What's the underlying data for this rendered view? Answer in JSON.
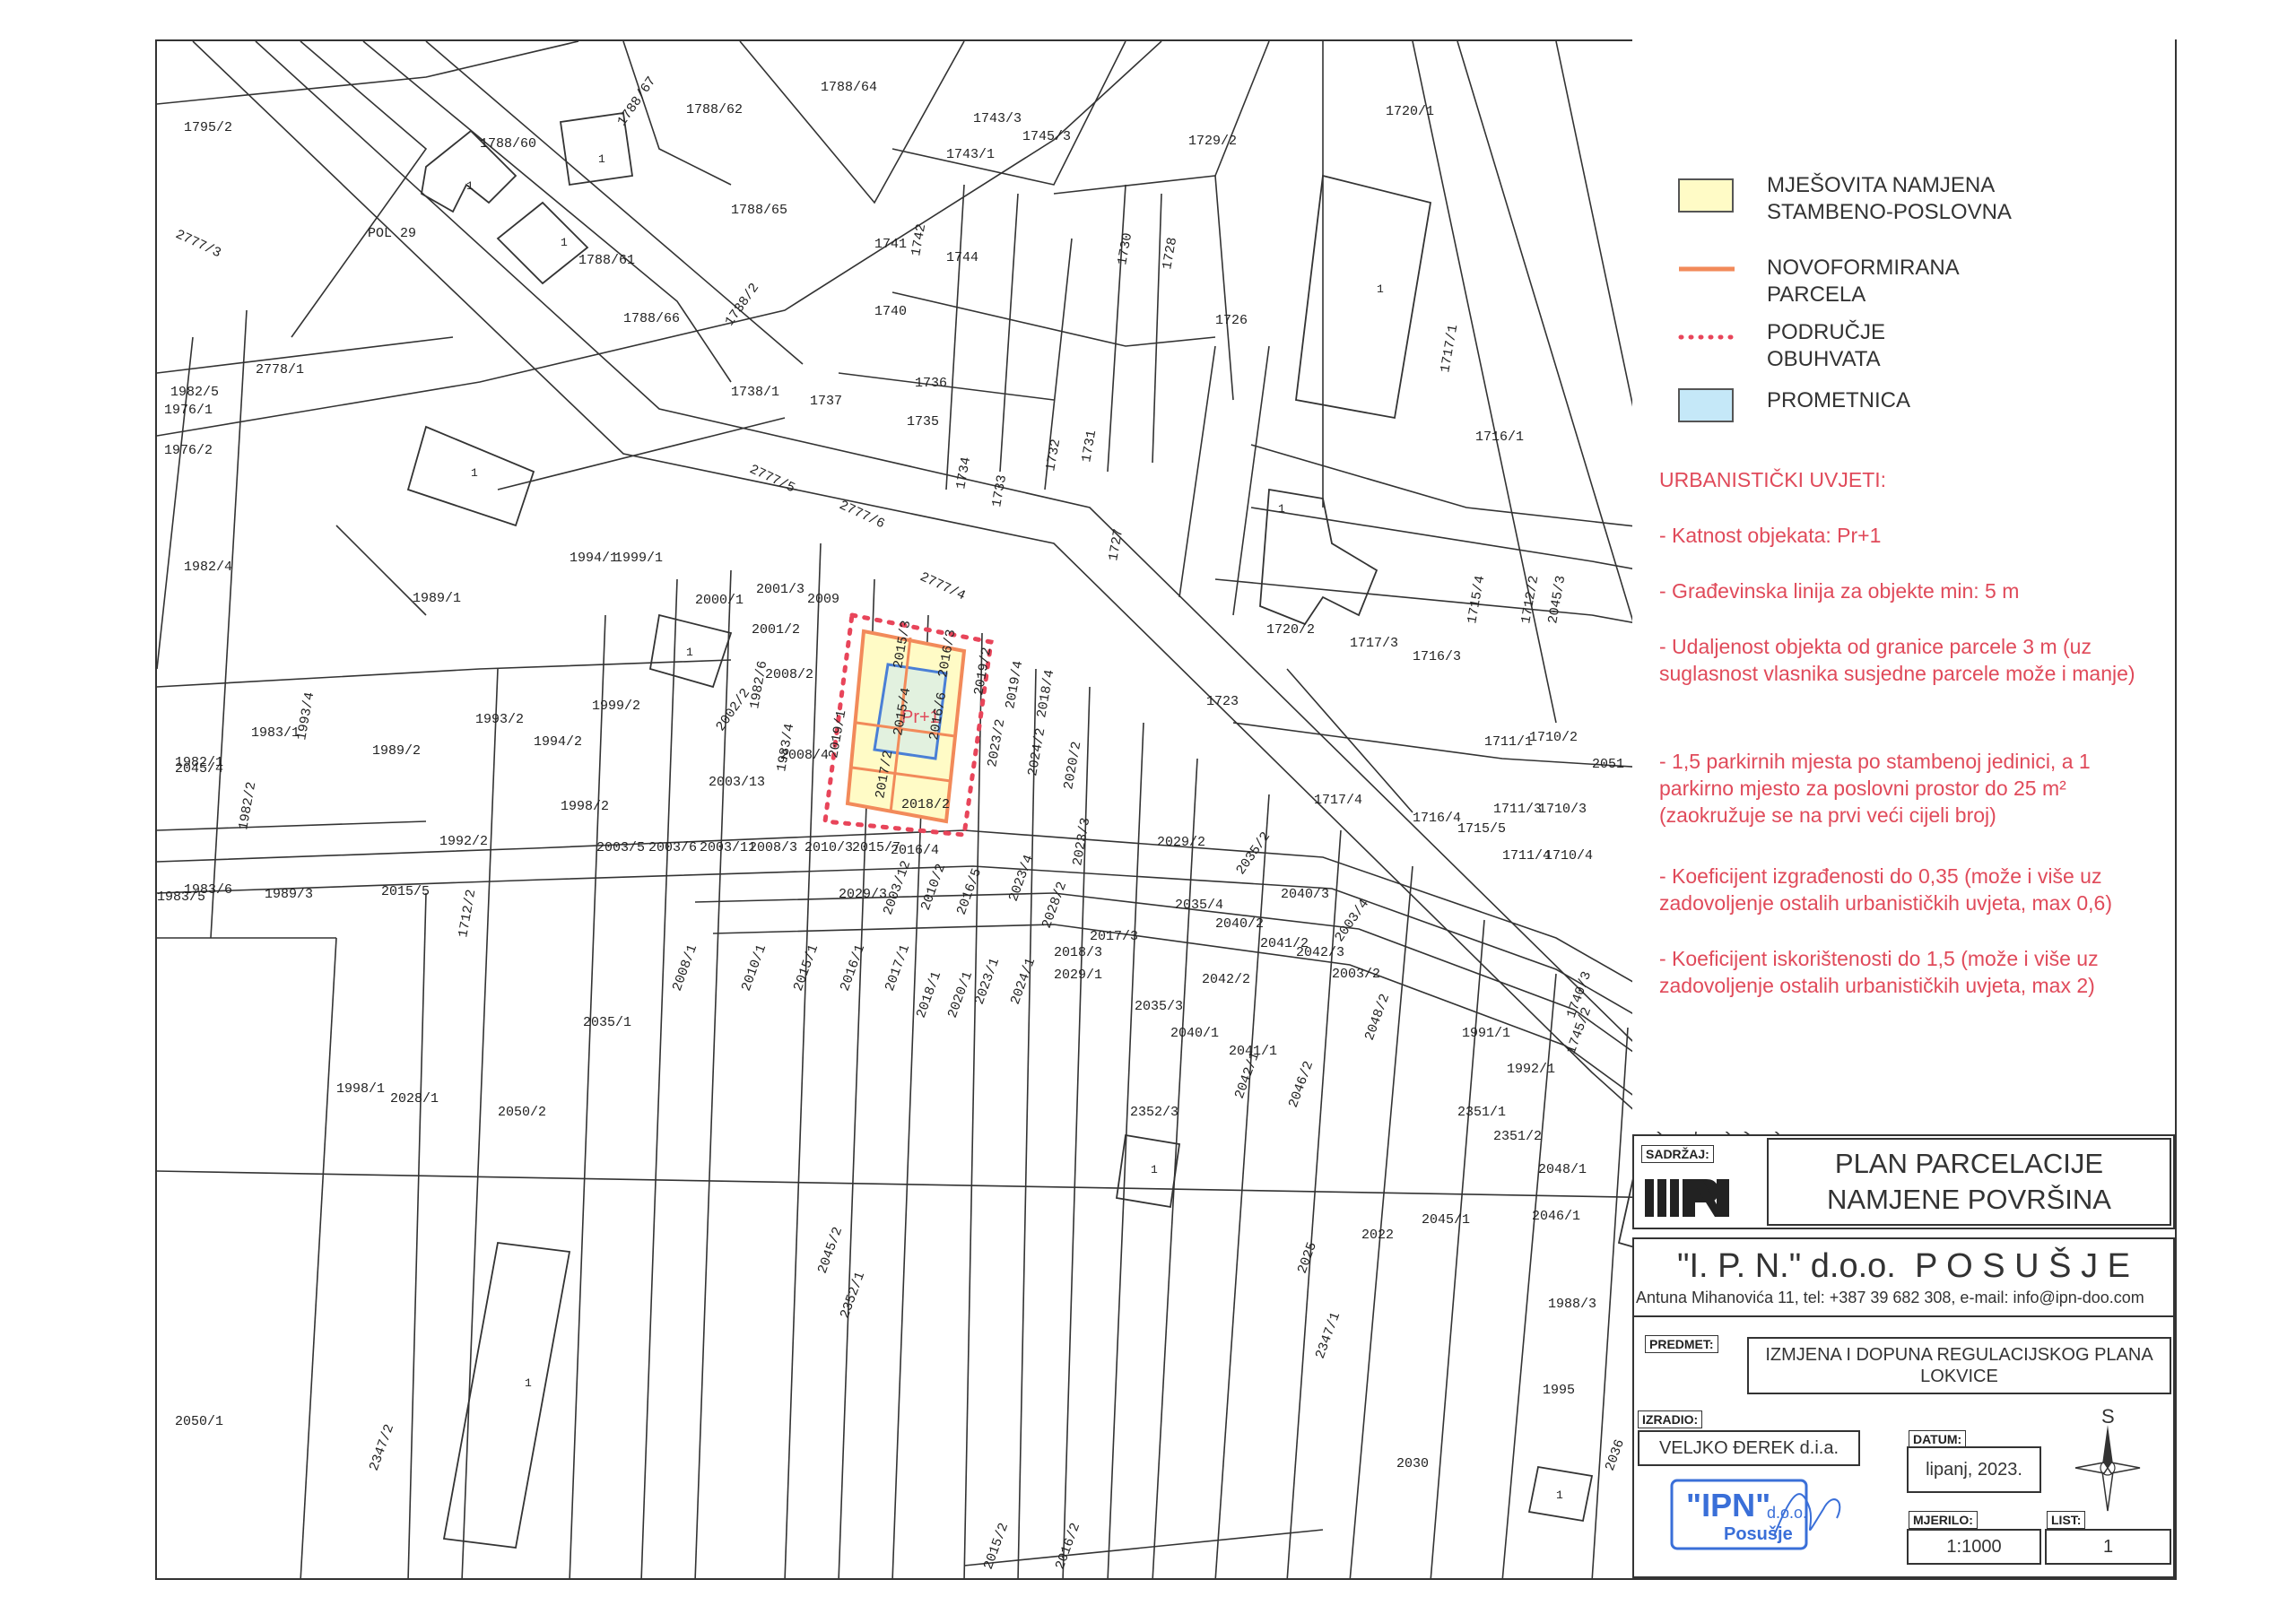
{
  "parcels": [
    {
      "id": "1795/2"
    },
    {
      "id": "1788/67"
    },
    {
      "id": "1788/62"
    },
    {
      "id": "1788/64"
    },
    {
      "id": "1788/60"
    },
    {
      "id": "1788/65"
    },
    {
      "id": "1788/61"
    },
    {
      "id": "1788/66"
    },
    {
      "id": "2777/3"
    },
    {
      "id": "POL 29"
    },
    {
      "id": "1738/2"
    },
    {
      "id": "1741"
    },
    {
      "id": "1742"
    },
    {
      "id": "1744"
    },
    {
      "id": "1740"
    },
    {
      "id": "1736"
    },
    {
      "id": "1737"
    },
    {
      "id": "1735"
    },
    {
      "id": "1738/1"
    },
    {
      "id": "1743/1"
    },
    {
      "id": "1743/3"
    },
    {
      "id": "1745/3"
    },
    {
      "id": "1729/2"
    },
    {
      "id": "1720/1"
    },
    {
      "id": "1730"
    },
    {
      "id": "1728"
    },
    {
      "id": "1726"
    },
    {
      "id": "1717/1"
    },
    {
      "id": "1716/1"
    },
    {
      "id": "2778/1"
    },
    {
      "id": "1982/5"
    },
    {
      "id": "1976/1"
    },
    {
      "id": "1976/2"
    },
    {
      "id": "2777/5"
    },
    {
      "id": "2777/6"
    },
    {
      "id": "2777/4"
    },
    {
      "id": "1734"
    },
    {
      "id": "1733"
    },
    {
      "id": "1732"
    },
    {
      "id": "1731"
    },
    {
      "id": "1727"
    },
    {
      "id": "1982/4"
    },
    {
      "id": "1989/1"
    },
    {
      "id": "1994/1"
    },
    {
      "id": "1999/1"
    },
    {
      "id": "2000/1"
    },
    {
      "id": "2001/3"
    },
    {
      "id": "2001/2"
    },
    {
      "id": "2009"
    },
    {
      "id": "2008/2"
    },
    {
      "id": "1720/2"
    },
    {
      "id": "1717/3"
    },
    {
      "id": "1716/3"
    },
    {
      "id": "1715/4"
    },
    {
      "id": "1712/2"
    },
    {
      "id": "1983/1"
    },
    {
      "id": "1982/1"
    },
    {
      "id": "1993/2"
    },
    {
      "id": "1994/2"
    },
    {
      "id": "1999/2"
    },
    {
      "id": "2002/2"
    },
    {
      "id": "2003/13"
    },
    {
      "id": "2008/4"
    },
    {
      "id": "1998/2"
    },
    {
      "id": "1989/2"
    },
    {
      "id": "1723"
    },
    {
      "id": "1711/1"
    },
    {
      "id": "1710/2"
    },
    {
      "id": "2051"
    },
    {
      "id": "1717/4"
    },
    {
      "id": "1716/4"
    },
    {
      "id": "1715/5"
    },
    {
      "id": "1711/3"
    },
    {
      "id": "1710/3"
    },
    {
      "id": "1711/4"
    },
    {
      "id": "1710/4"
    },
    {
      "id": "1992/2"
    },
    {
      "id": "2003/5"
    },
    {
      "id": "2003/6"
    },
    {
      "id": "2003/11"
    },
    {
      "id": "2008/3"
    },
    {
      "id": "2010/3"
    },
    {
      "id": "2015/7"
    },
    {
      "id": "2016/4"
    },
    {
      "id": "2029/2"
    },
    {
      "id": "2035/2"
    },
    {
      "id": "2040/3"
    },
    {
      "id": "1983/6"
    },
    {
      "id": "1989/3"
    },
    {
      "id": "2015/5"
    },
    {
      "id": "2029/3"
    },
    {
      "id": "2035/4"
    },
    {
      "id": "2040/2"
    },
    {
      "id": "2041/2"
    },
    {
      "id": "2042/3"
    },
    {
      "id": "2003/4"
    },
    {
      "id": "2008/1"
    },
    {
      "id": "2010/1"
    },
    {
      "id": "2015/1"
    },
    {
      "id": "2016/1"
    },
    {
      "id": "2017/1"
    },
    {
      "id": "2018/1"
    },
    {
      "id": "2020/1"
    },
    {
      "id": "2023/1"
    },
    {
      "id": "2024/1"
    },
    {
      "id": "2029/1"
    },
    {
      "id": "2035/3"
    },
    {
      "id": "2042/2"
    },
    {
      "id": "2003/2"
    },
    {
      "id": "2035/1"
    },
    {
      "id": "2040/1"
    },
    {
      "id": "2041/1"
    },
    {
      "id": "2042/1"
    },
    {
      "id": "2046/2"
    },
    {
      "id": "2048/2"
    },
    {
      "id": "1991/1"
    },
    {
      "id": "1992/1"
    },
    {
      "id": "1998/1"
    },
    {
      "id": "2028/1"
    },
    {
      "id": "2050/2"
    },
    {
      "id": "2352/3"
    },
    {
      "id": "2351/1"
    },
    {
      "id": "2351/2"
    },
    {
      "id": "2048/1"
    },
    {
      "id": "2046/1"
    },
    {
      "id": "2045/1"
    },
    {
      "id": "2022"
    },
    {
      "id": "2025"
    },
    {
      "id": "2045/2"
    },
    {
      "id": "2352/1"
    },
    {
      "id": "2347/1"
    },
    {
      "id": "1988/3"
    },
    {
      "id": "1995"
    },
    {
      "id": "2050/1"
    },
    {
      "id": "2347/2"
    },
    {
      "id": "2030"
    },
    {
      "id": "2036"
    },
    {
      "id": "2015/2"
    },
    {
      "id": "2016/2"
    },
    {
      "id": "2015/3"
    },
    {
      "id": "2016/3"
    },
    {
      "id": "2015/4"
    },
    {
      "id": "2016/6"
    },
    {
      "id": "2017/2"
    },
    {
      "id": "2018/2"
    },
    {
      "id": "2019/2"
    },
    {
      "id": "2019/4"
    },
    {
      "id": "2018/4"
    },
    {
      "id": "2019/1"
    },
    {
      "id": "2023/2"
    },
    {
      "id": "2024/2"
    },
    {
      "id": "2020/2"
    },
    {
      "id": "2023/3"
    },
    {
      "id": "2023/4"
    },
    {
      "id": "2028/2"
    },
    {
      "id": "2018/3"
    },
    {
      "id": "2017/3"
    },
    {
      "id": "2016/5"
    },
    {
      "id": "2010/2"
    },
    {
      "id": "2003/12"
    },
    {
      "id": "1982/6"
    },
    {
      "id": "1983/4"
    },
    {
      "id": "1983/5"
    },
    {
      "id": "1993/4"
    },
    {
      "id": "1982/2"
    },
    {
      "id": "1712/2"
    },
    {
      "id": "2045/4"
    },
    {
      "id": "2045/3"
    },
    {
      "id": "1740/3"
    },
    {
      "id": "1745/2"
    }
  ],
  "building_mark": "1",
  "zone_label": "Pr+1",
  "legend": {
    "items": [
      {
        "label": "MJEŠOVITA NAMJENA\nSTAMBENO-POSLOVNA",
        "swatch_fill": "#fffbc6",
        "swatch_stroke": "#555555"
      },
      {
        "label": "NOVOFORMIRANA PARCELA",
        "line_color": "#f28a5a"
      },
      {
        "label": "PODRUČJE OBUHVATA",
        "dot_color": "#e8455a"
      },
      {
        "label": "PROMETNICA",
        "swatch_fill": "#c5e8f8",
        "swatch_stroke": "#555555"
      }
    ],
    "conditions_title": "URBANISTIČKI UVJETI:",
    "conditions": [
      "- Katnost objekata: Pr+1",
      "- Građevinska linija za objekte min: 5 m",
      "- Udaljenost objekta od granice parcele 3 m (uz suglasnost vlasnika susjedne parcele može i manje)",
      "- 1,5 parkirnih mjesta po stambenoj jedinici, a 1 parkirno mjesto za poslovni prostor do 25 m² (zaokružuje se na prvi veći cijeli broj)",
      "- Koeficijent izgrađenosti do 0,35 (može i više uz zadovoljenje ostalih urbanističkih uvjeta, max 0,6)",
      "- Koeficijent iskorištenosti do 1,5 (može i više uz zadovoljenje ostalih urbanističkih uvjeta, max 2)"
    ],
    "condition_color": "#e04a5a"
  },
  "titleblock": {
    "sadrzaj_label": "SADRŽAJ:",
    "logo_text": "IPN",
    "title_line1": "PLAN PARCELACIJE",
    "title_line2": "NAMJENE POVRŠINA",
    "company": "\"I. P. N.\" d.o.o.  P O S U Š J E",
    "address": "Antuna Mihanovića 11,  tel: +387 39 682 308, e-mail: info@ipn-doo.com",
    "predmet_label": "PREDMET:",
    "predmet_line1": "IZMJENA I DOPUNA REGULACIJSKOG PLANA",
    "predmet_line2": "LOKVICE",
    "izradio_label": "IZRADIO:",
    "izradio": "VELJKO ĐEREK d.i.a.",
    "datum_label": "DATUM:",
    "datum": "lipanj, 2023.",
    "mjerilo_label": "MJERILO:",
    "mjerilo": "1:1000",
    "list_label": "LIST:",
    "list": "1",
    "north_label": "S",
    "stamp_big": "\"IPN\"",
    "stamp_doo": "d.o.o.",
    "stamp_city": "Posušje"
  }
}
